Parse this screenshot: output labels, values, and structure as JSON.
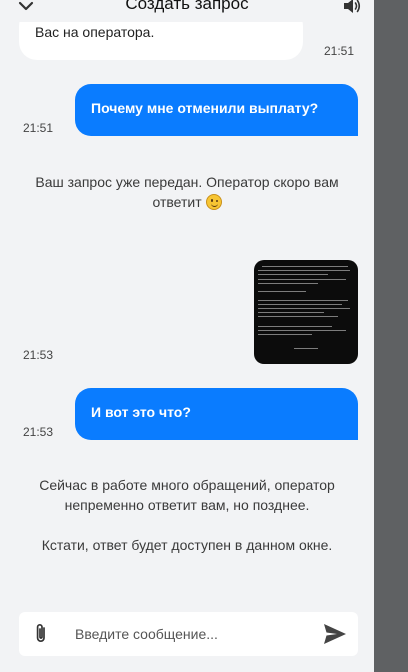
{
  "header": {
    "title": "Создать запрос",
    "collapse_icon": "chevron-down-icon",
    "sound_icon": "speaker-icon"
  },
  "messages": [
    {
      "type": "incoming",
      "text": "Вас на оператора.",
      "time": "21:51"
    },
    {
      "type": "outgoing",
      "text": "Почему мне отменили выплату?",
      "time": "21:51"
    },
    {
      "type": "system",
      "text": "Ваш запрос уже передан. Оператор скоро вам ответит",
      "emoji": "slightly-smiling-face"
    },
    {
      "type": "outgoing-image",
      "time": "21:53"
    },
    {
      "type": "outgoing",
      "text": "И вот это что?",
      "time": "21:53"
    },
    {
      "type": "system",
      "text": "Сейчас в работе много обращений, оператор непременно ответит вам, но позднее."
    },
    {
      "type": "system",
      "text": "Кстати, ответ будет доступен в данном окне."
    }
  ],
  "composer": {
    "placeholder": "Введите сообщение...",
    "value": "",
    "attach_icon": "paperclip-icon",
    "send_icon": "send-icon"
  },
  "colors": {
    "panel_bg": "#f2f3f5",
    "outgoing_bubble": "#0a7cff",
    "incoming_bubble": "#ffffff",
    "right_strip": "#5f6163"
  }
}
